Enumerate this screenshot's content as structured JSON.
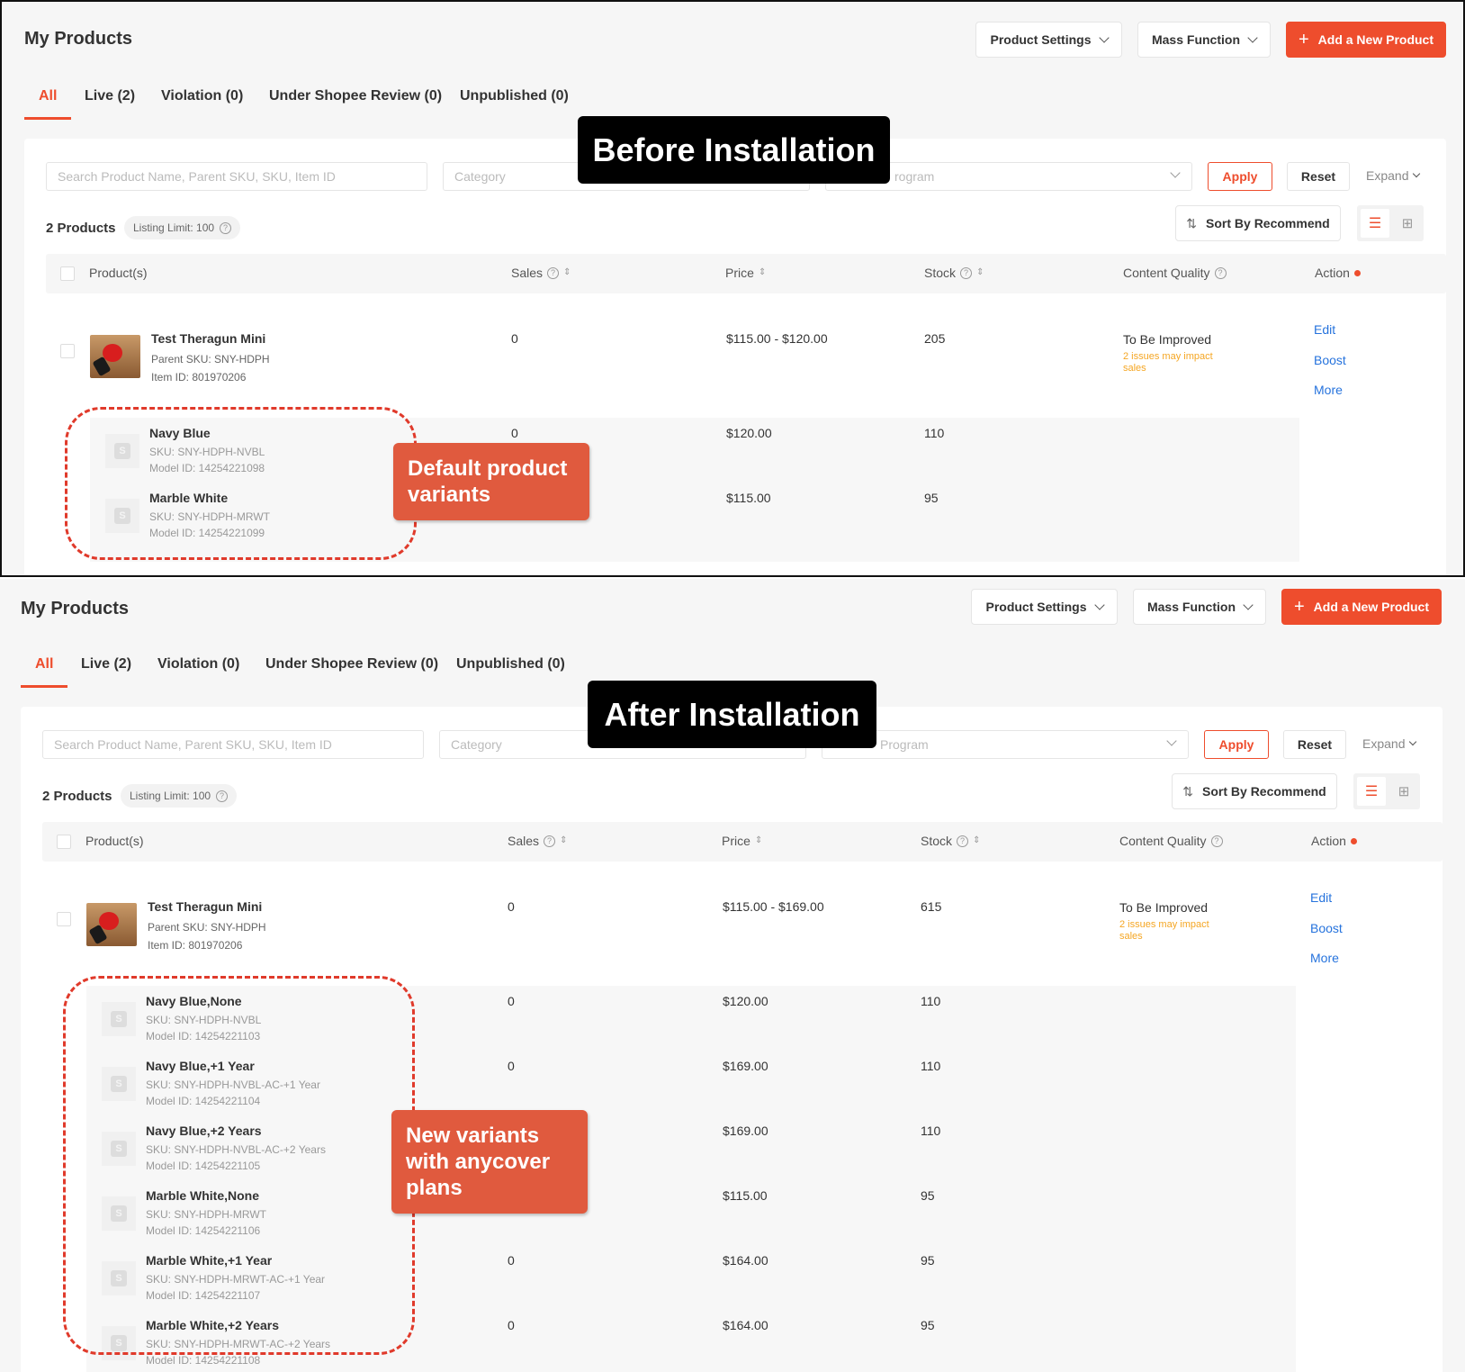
{
  "header": {
    "title": "My Products",
    "product_settings": "Product Settings",
    "mass_function": "Mass Function",
    "add_product": "Add a New Product"
  },
  "tabs": [
    "All",
    "Live (2)",
    "Violation (0)",
    "Under Shopee Review (0)",
    "Unpublished (0)"
  ],
  "filters": {
    "search_placeholder": "Search Product Name, Parent SKU, SKU, Item ID",
    "category_placeholder": "Category",
    "program_placeholder_before": "rogram",
    "program_placeholder_after": "Program",
    "apply": "Apply",
    "reset": "Reset",
    "expand": "Expand"
  },
  "summary": {
    "count": "2 Products",
    "listing_limit": "Listing Limit: 100",
    "sort": "Sort By Recommend"
  },
  "table_headers": {
    "products": "Product(s)",
    "sales": "Sales",
    "price": "Price",
    "stock": "Stock",
    "content_quality": "Content Quality",
    "action": "Action"
  },
  "before": {
    "banner": "Before Installation",
    "callout": "Default product variants",
    "product": {
      "name": "Test Theragun Mini",
      "parent_sku": "Parent SKU: SNY-HDPH",
      "item_id": "Item ID: 801970206",
      "sales": "0",
      "price": "$115.00 - $120.00",
      "stock": "205",
      "quality": "To Be Improved",
      "quality_note": "2 issues may impact sales"
    },
    "variants": [
      {
        "name": "Navy Blue",
        "sku": "SKU: SNY-HDPH-NVBL",
        "model": "Model ID: 14254221098",
        "sales": "0",
        "price": "$120.00",
        "stock": "110"
      },
      {
        "name": "Marble White",
        "sku": "SKU: SNY-HDPH-MRWT",
        "model": "Model ID: 14254221099",
        "sales": "",
        "price": "$115.00",
        "stock": "95"
      }
    ]
  },
  "after": {
    "banner": "After Installation",
    "callout": "New variants with anycover plans",
    "product": {
      "name": "Test Theragun Mini",
      "parent_sku": "Parent SKU: SNY-HDPH",
      "item_id": "Item ID: 801970206",
      "sales": "0",
      "price": "$115.00 - $169.00",
      "stock": "615",
      "quality": "To Be Improved",
      "quality_note": "2 issues may impact sales"
    },
    "variants": [
      {
        "name": "Navy Blue,None",
        "sku": "SKU: SNY-HDPH-NVBL",
        "model": "Model ID: 14254221103",
        "sales": "0",
        "price": "$120.00",
        "stock": "110"
      },
      {
        "name": "Navy Blue,+1 Year",
        "sku": "SKU: SNY-HDPH-NVBL-AC-+1 Year",
        "model": "Model ID: 14254221104",
        "sales": "0",
        "price": "$169.00",
        "stock": "110"
      },
      {
        "name": "Navy Blue,+2 Years",
        "sku": "SKU: SNY-HDPH-NVBL-AC-+2 Years",
        "model": "Model ID: 14254221105",
        "sales": "",
        "price": "$169.00",
        "stock": "110"
      },
      {
        "name": "Marble White,None",
        "sku": "SKU: SNY-HDPH-MRWT",
        "model": "Model ID: 14254221106",
        "sales": "",
        "price": "$115.00",
        "stock": "95"
      },
      {
        "name": "Marble White,+1 Year",
        "sku": "SKU: SNY-HDPH-MRWT-AC-+1 Year",
        "model": "Model ID: 14254221107",
        "sales": "0",
        "price": "$164.00",
        "stock": "95"
      },
      {
        "name": "Marble White,+2 Years",
        "sku": "SKU: SNY-HDPH-MRWT-AC-+2 Years",
        "model": "Model ID: 14254221108",
        "sales": "0",
        "price": "$164.00",
        "stock": "95"
      }
    ]
  },
  "actions": [
    "Edit",
    "Boost",
    "More"
  ],
  "colors": {
    "accent": "#ee4d2d",
    "link": "#2673dd",
    "warning": "#f5a623",
    "callout": "#e05a3e"
  }
}
